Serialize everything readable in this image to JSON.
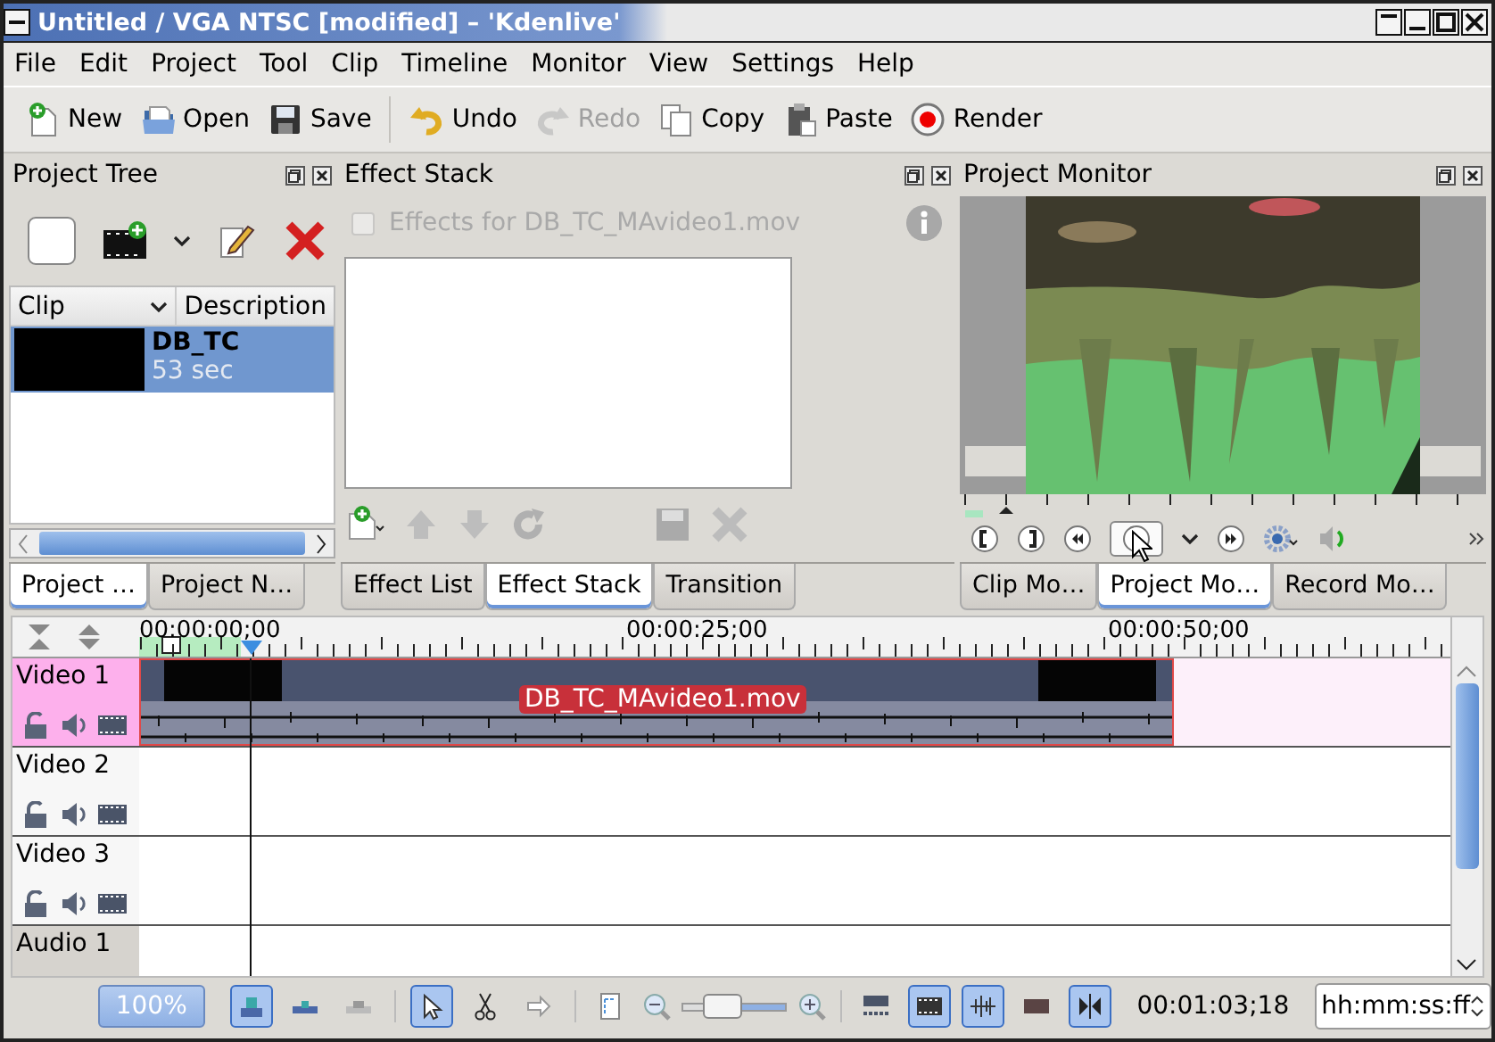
{
  "window": {
    "title": "Untitled / VGA NTSC [modified] – 'Kdenlive'"
  },
  "menu": [
    "File",
    "Edit",
    "Project",
    "Tool",
    "Clip",
    "Timeline",
    "Monitor",
    "View",
    "Settings",
    "Help"
  ],
  "toolbar": [
    {
      "label": "New",
      "disabled": false
    },
    {
      "label": "Open",
      "disabled": false
    },
    {
      "label": "Save",
      "disabled": false
    },
    {
      "label": "Undo",
      "disabled": false
    },
    {
      "label": "Redo",
      "disabled": true
    },
    {
      "label": "Copy",
      "disabled": false
    },
    {
      "label": "Paste",
      "disabled": false
    },
    {
      "label": "Render",
      "disabled": false
    }
  ],
  "project_tree": {
    "title": "Project Tree",
    "columns": [
      "Clip",
      "Description"
    ],
    "clips": [
      {
        "name": "DB_TC",
        "duration": "53 sec",
        "selected": true
      }
    ],
    "tabs": [
      {
        "label": "Project …",
        "selected": true
      },
      {
        "label": "Project N…",
        "selected": false
      }
    ]
  },
  "effect_stack": {
    "title": "Effect Stack",
    "enable": {
      "label": "Effects for DB_TC_MAvideo1.mov",
      "checked": false,
      "disabled": true
    },
    "tabs": [
      {
        "label": "Effect List",
        "selected": false
      },
      {
        "label": "Effect Stack",
        "selected": true
      },
      {
        "label": "Transition",
        "selected": false
      }
    ]
  },
  "project_monitor": {
    "title": "Project Monitor",
    "tabs": [
      {
        "label": "Clip Mo…",
        "selected": false
      },
      {
        "label": "Project Mo…",
        "selected": true
      },
      {
        "label": "Record Mo…",
        "selected": false
      }
    ]
  },
  "timeline": {
    "ruler": [
      "00:00:00;00",
      "00:00:25;00",
      "00:00:50;00"
    ],
    "tracks": [
      {
        "name": "Video 1",
        "kind": "video",
        "selected": true,
        "clip": "DB_TC_MAvideo1.mov"
      },
      {
        "name": "Video 2",
        "kind": "video",
        "selected": false
      },
      {
        "name": "Video 3",
        "kind": "video",
        "selected": false
      },
      {
        "name": "Audio 1",
        "kind": "audio",
        "selected": false
      }
    ]
  },
  "status_bar": {
    "zoom": "100%",
    "zoom_slider": {
      "level": 0.4
    },
    "tools": [
      {
        "on": true
      },
      {
        "on": false
      },
      {
        "on": false
      },
      {
        "on": true
      },
      {
        "on": false
      },
      {
        "on": false
      },
      {
        "on": false
      },
      {
        "on": false
      },
      {
        "on": true
      },
      {
        "on": true
      },
      {
        "on": false
      },
      {
        "on": true
      }
    ],
    "timecode": "00:01:03;18",
    "format": "hh:mm:ss:ff"
  }
}
